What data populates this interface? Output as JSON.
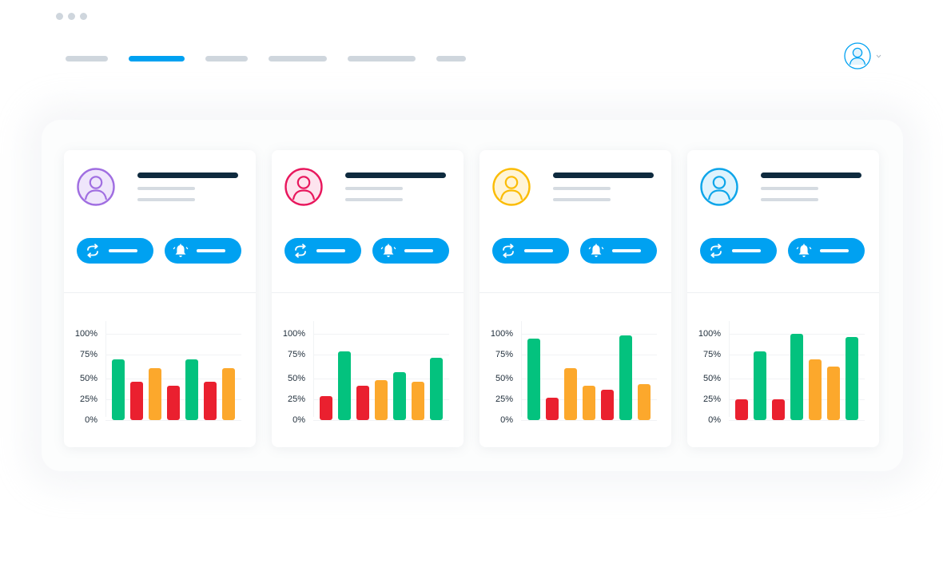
{
  "colors": {
    "accent": "#00a1f1",
    "nav_inactive": "#cfd6dd",
    "title_line": "#0e2a3e",
    "good": "#03c27e",
    "bad": "#ea202f",
    "medium": "#fca82c"
  },
  "nav": {
    "active_index": 1,
    "tab_count": 6
  },
  "user_menu": {
    "icon": "user-avatar-icon",
    "dropdown_icon": "chevron-down-icon"
  },
  "cards": [
    {
      "avatar_color": "#a06ee1",
      "avatar_fill": "#efe6fb",
      "button_icons": [
        "refresh-icon",
        "bell-icon"
      ],
      "chart_data": {
        "type": "bar",
        "ylim": [
          0,
          100
        ],
        "ytick_labels": [
          "100%",
          "75%",
          "50%",
          "25%",
          "0%"
        ],
        "values": [
          70,
          44,
          60,
          40,
          70,
          44,
          60
        ],
        "bar_colors": [
          "good",
          "bad",
          "medium",
          "bad",
          "good",
          "bad",
          "medium"
        ]
      }
    },
    {
      "avatar_color": "#e8175d",
      "avatar_fill": "#fde4ee",
      "button_icons": [
        "refresh-icon",
        "bell-icon"
      ],
      "chart_data": {
        "type": "bar",
        "ylim": [
          0,
          100
        ],
        "ytick_labels": [
          "100%",
          "75%",
          "50%",
          "25%",
          "0%"
        ],
        "values": [
          28,
          80,
          40,
          46,
          56,
          44,
          72
        ],
        "bar_colors": [
          "bad",
          "good",
          "bad",
          "medium",
          "good",
          "medium",
          "good"
        ]
      }
    },
    {
      "avatar_color": "#fbbc05",
      "avatar_fill": "#fff4d6",
      "button_icons": [
        "refresh-icon",
        "bell-icon"
      ],
      "chart_data": {
        "type": "bar",
        "ylim": [
          0,
          100
        ],
        "ytick_labels": [
          "100%",
          "75%",
          "50%",
          "25%",
          "0%"
        ],
        "values": [
          94,
          26,
          60,
          40,
          35,
          98,
          42
        ],
        "bar_colors": [
          "good",
          "bad",
          "medium",
          "medium",
          "bad",
          "good",
          "medium"
        ]
      }
    },
    {
      "avatar_color": "#0ea5e9",
      "avatar_fill": "#dff3fd",
      "button_icons": [
        "refresh-icon",
        "bell-icon"
      ],
      "chart_data": {
        "type": "bar",
        "ylim": [
          0,
          100
        ],
        "ytick_labels": [
          "100%",
          "75%",
          "50%",
          "25%",
          "0%"
        ],
        "values": [
          24,
          80,
          24,
          100,
          70,
          62,
          96
        ],
        "bar_colors": [
          "bad",
          "good",
          "bad",
          "good",
          "medium",
          "medium",
          "good"
        ]
      }
    }
  ]
}
